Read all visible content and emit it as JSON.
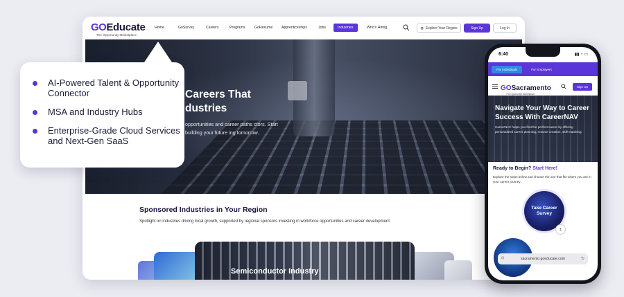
{
  "desktop": {
    "logo": {
      "go": "GO",
      "brand": "Educate",
      "tagline": "The Opportunity Marketplace"
    },
    "nav": {
      "items": [
        "Home",
        "GoSurvey",
        "Careers",
        "Programs",
        "GoResume",
        "Apprenticeships",
        "Jobs",
        "Industries",
        "Who's Hiring"
      ],
      "active": "Industries",
      "region_button": "Explore Your Region",
      "signup": "Sign Up",
      "login": "Log In"
    },
    "hero": {
      "title": "Careers That dustries",
      "subtitle": "opportunities and career paths ctors. Start building your future ing tomorrow."
    },
    "section": {
      "title": "Sponsored Industries in Your Region",
      "subtitle": "Spotlight on industries driving local growth, supported by regional sponsors investing in workforce opportunities and career development."
    },
    "featured_card": "Semiconductor Industry"
  },
  "callout": {
    "items": [
      "AI-Powered Talent & Opportunity Connector",
      "MSA and Industry Hubs",
      "Enterprise-Grade Cloud Services and Next-Gen SaaS"
    ]
  },
  "phone": {
    "time": "6:40",
    "tabs": [
      "For Individuals",
      "For Employers"
    ],
    "logo": {
      "go": "GO",
      "brand": "Sacramento",
      "tagline": "The Opportunity Marketplace"
    },
    "signup": "Sign Up",
    "hero": {
      "title": "Navigate Your Way to Career Success With CareerNAV",
      "subtitle": "CareerNAV helps you find the perfect career by offering personalized career planning, resume creation, skill matching."
    },
    "ready": {
      "lead": "Ready to Begin?",
      "accent": "Start Here!"
    },
    "ready_sub": "Explore the steps below and choose the one that fits where you are in your career journey.",
    "step_circle": "Take Career Survey",
    "step_number": "1",
    "url": "sacramento.goeducate.com"
  },
  "colors": {
    "accent": "#5a35d8",
    "dark": "#1b1b3a"
  }
}
